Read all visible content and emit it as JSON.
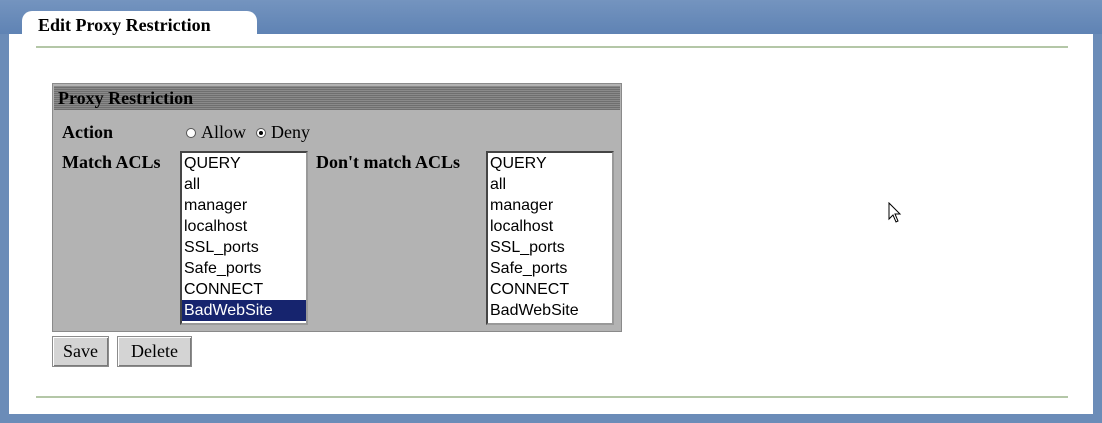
{
  "tab": {
    "title": "Edit Proxy Restriction"
  },
  "section": {
    "legend": "Proxy Restriction"
  },
  "action": {
    "label": "Action",
    "options": [
      {
        "label": "Allow",
        "selected": false
      },
      {
        "label": "Deny",
        "selected": true
      }
    ]
  },
  "match": {
    "label": "Match ACLs",
    "items": [
      "QUERY",
      "all",
      "manager",
      "localhost",
      "SSL_ports",
      "Safe_ports",
      "CONNECT",
      "BadWebSite"
    ],
    "selected": "BadWebSite"
  },
  "nomatch": {
    "label": "Don't match ACLs",
    "items": [
      "QUERY",
      "all",
      "manager",
      "localhost",
      "SSL_ports",
      "Safe_ports",
      "CONNECT",
      "BadWebSite"
    ]
  },
  "buttons": {
    "save": "Save",
    "delete": "Delete"
  },
  "colors": {
    "frame": "#6b8cb8",
    "selection": "#16246e",
    "panel_bg": "#b3b3b3"
  }
}
